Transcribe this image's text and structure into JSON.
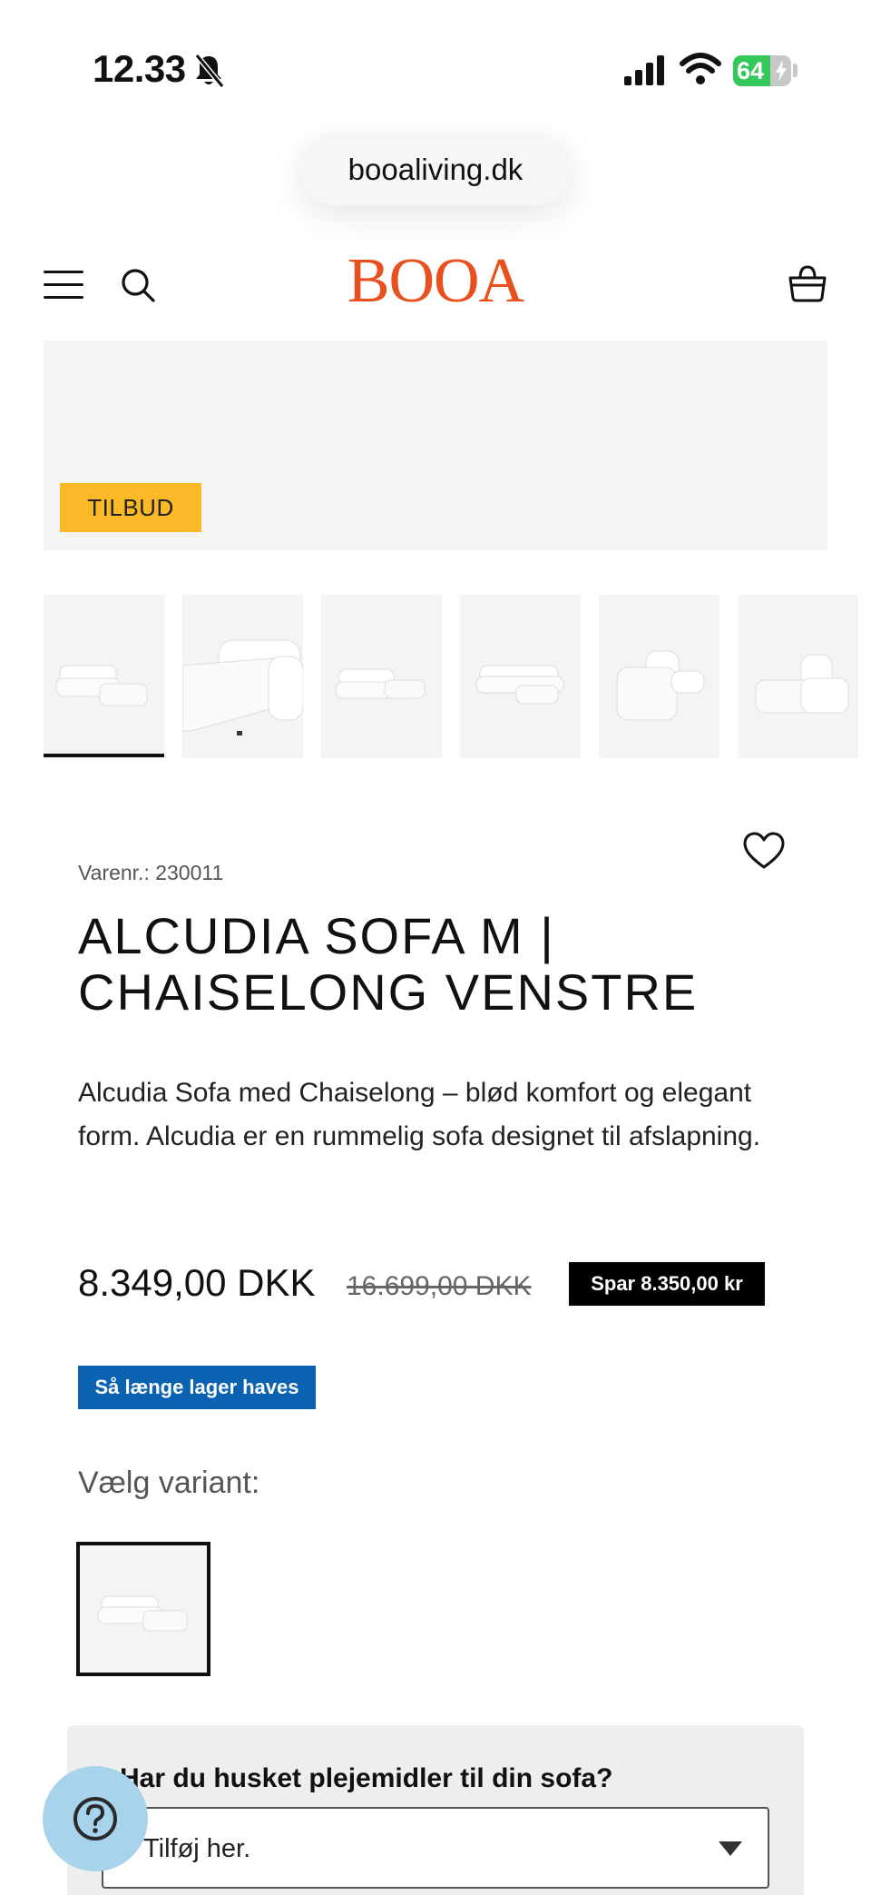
{
  "status_bar": {
    "time": "12.33",
    "battery_percent": "64",
    "battery_level": 0.64
  },
  "browser": {
    "url": "booaliving.dk"
  },
  "header": {
    "logo_text": "BOOA",
    "brand_color": "#e8501e"
  },
  "gallery": {
    "badge": "TILBUD",
    "badge_color": "#fbb928",
    "thumbnail_count": 6,
    "active_thumbnail": 1
  },
  "product": {
    "sku_label": "Varenr.: 230011",
    "title": "ALCUDIA SOFA M | CHAISELONG VENSTRE",
    "description": "Alcudia Sofa med Chaiselong – blød komfort og elegant form. Alcudia er en rummelig sofa designet til afslapning.",
    "price": "8.349,00 DKK",
    "compare_price": "16.699,00 DKK",
    "save_label": "Spar 8.350,00 kr",
    "stock_label": "Så længe lager haves",
    "stock_color": "#0a62b0",
    "variant_label": "Vælg variant:"
  },
  "care": {
    "title": "Har du husket plejemidler til din sofa?",
    "select_value": "Tilføj her."
  },
  "help": {
    "icon": "question-icon"
  }
}
